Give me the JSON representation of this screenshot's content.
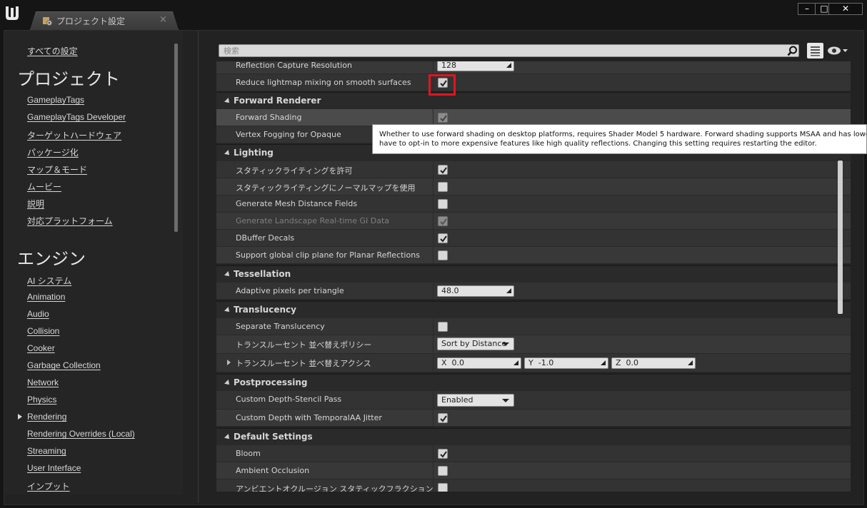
{
  "window": {
    "tab_title": "プロジェクト設定",
    "tab_close": "×",
    "min_label": "–",
    "max_label": "□",
    "close_label": "✕"
  },
  "sidebar": {
    "all_settings": "すべての設定",
    "project_heading": "プロジェクト",
    "project_items": [
      "GameplayTags",
      "GameplayTags Developer",
      "ターゲットハードウェア",
      "パッケージ化",
      "マップ＆モード",
      "ムービー",
      "説明",
      "対応プラットフォーム"
    ],
    "engine_heading": "エンジン",
    "engine_items": [
      "AI システム",
      "Animation",
      "Audio",
      "Collision",
      "Cooker",
      "Garbage Collection",
      "Network",
      "Physics",
      "Rendering",
      "Rendering Overrides (Local)",
      "Streaming",
      "User Interface",
      "インプット"
    ],
    "selected_item": "Rendering"
  },
  "search": {
    "placeholder": "検索"
  },
  "rows": {
    "reflection_capture_resolution": {
      "label": "Reflection Capture Resolution",
      "value": "128"
    },
    "reduce_lightmap_mixing": {
      "label": "Reduce lightmap mixing on smooth surfaces",
      "checked": true
    },
    "forward_renderer": {
      "title": "Forward Renderer"
    },
    "forward_shading": {
      "label": "Forward Shading",
      "checked": true
    },
    "vertex_fogging": {
      "label": "Vertex Fogging for Opaque"
    },
    "lighting": {
      "title": "Lighting"
    },
    "allow_static_lighting": {
      "label": "スタティックライティングを許可",
      "checked": true
    },
    "normal_maps_static": {
      "label": "スタティックライティングにノーマルマップを使用",
      "checked": false
    },
    "mesh_distance_fields": {
      "label": "Generate Mesh Distance Fields",
      "checked": false
    },
    "landscape_gi": {
      "label": "Generate Landscape Real-time GI Data",
      "checked": true
    },
    "dbuffer_decals": {
      "label": "DBuffer Decals",
      "checked": true
    },
    "global_clip_plane": {
      "label": "Support global clip plane for Planar Reflections",
      "checked": false
    },
    "tessellation": {
      "title": "Tessellation"
    },
    "adaptive_pixels": {
      "label": "Adaptive pixels per triangle",
      "value": "48.0"
    },
    "translucency": {
      "title": "Translucency"
    },
    "separate_translucency": {
      "label": "Separate Translucency",
      "checked": false
    },
    "sort_policy": {
      "label": "トランスルーセント 並べ替えポリシー",
      "value": "Sort by Distance"
    },
    "sort_axis": {
      "label": "トランスルーセント 並べ替えアクシス",
      "x_label": "X",
      "x": "0.0",
      "y_label": "Y",
      "y": "-1.0",
      "z_label": "Z",
      "z": "0.0"
    },
    "postprocessing": {
      "title": "Postprocessing"
    },
    "custom_depth_stencil": {
      "label": "Custom Depth-Stencil Pass",
      "value": "Enabled"
    },
    "custom_depth_taa": {
      "label": "Custom Depth with TemporalAA Jitter",
      "checked": true
    },
    "default_settings": {
      "title": "Default Settings"
    },
    "bloom": {
      "label": "Bloom",
      "checked": true
    },
    "ambient_occlusion": {
      "label": "Ambient Occlusion",
      "checked": false
    },
    "ao_static_fraction": {
      "label": "アンビエントオクルージョン スタティックフラクション",
      "checked": false
    }
  },
  "tooltip": {
    "line1": "Whether to use forward shading on desktop platforms, requires Shader Model 5 hardware.  Forward shading supports MSAA and has lowe",
    "line2": "have to opt-in to more expensive features like high quality reflections.  Changing this setting requires restarting the editor."
  },
  "colors": {
    "accent_highlight": "#e01520",
    "panel": "#333333",
    "background": "#151515"
  }
}
